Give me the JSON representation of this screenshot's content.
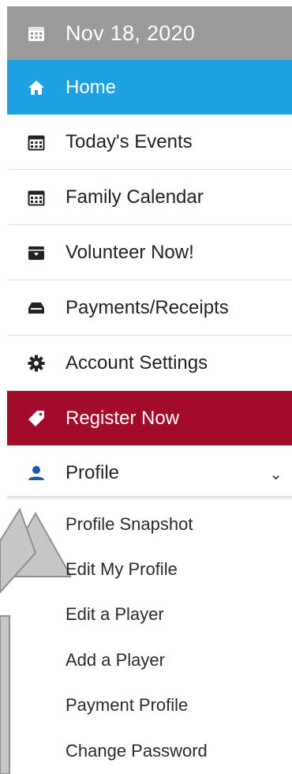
{
  "date_bar": {
    "date": "Nov 18, 2020",
    "icon": "calendar-icon"
  },
  "nav": [
    {
      "label": "Home",
      "icon": "home-icon",
      "active": true
    },
    {
      "label": "Today's Events",
      "icon": "calendar-icon"
    },
    {
      "label": "Family Calendar",
      "icon": "calendar-icon"
    },
    {
      "label": "Volunteer Now!",
      "icon": "archive-icon"
    },
    {
      "label": "Payments/Receipts",
      "icon": "inbox-tray-icon"
    },
    {
      "label": "Account Settings",
      "icon": "gear-icon"
    },
    {
      "label": "Register Now",
      "icon": "tag-icon",
      "highlight": true
    },
    {
      "label": "Profile",
      "icon": "user-icon",
      "expanded": true
    }
  ],
  "profile_submenu": [
    "Profile Snapshot",
    "Edit My Profile",
    "Edit a Player",
    "Add a Player",
    "Payment Profile",
    "Change Password"
  ],
  "colors": {
    "date_bar": "#9a9a9a",
    "home_active": "#1ea1e3",
    "register": "#a30b2a",
    "profile_icon": "#1c5aa8"
  }
}
